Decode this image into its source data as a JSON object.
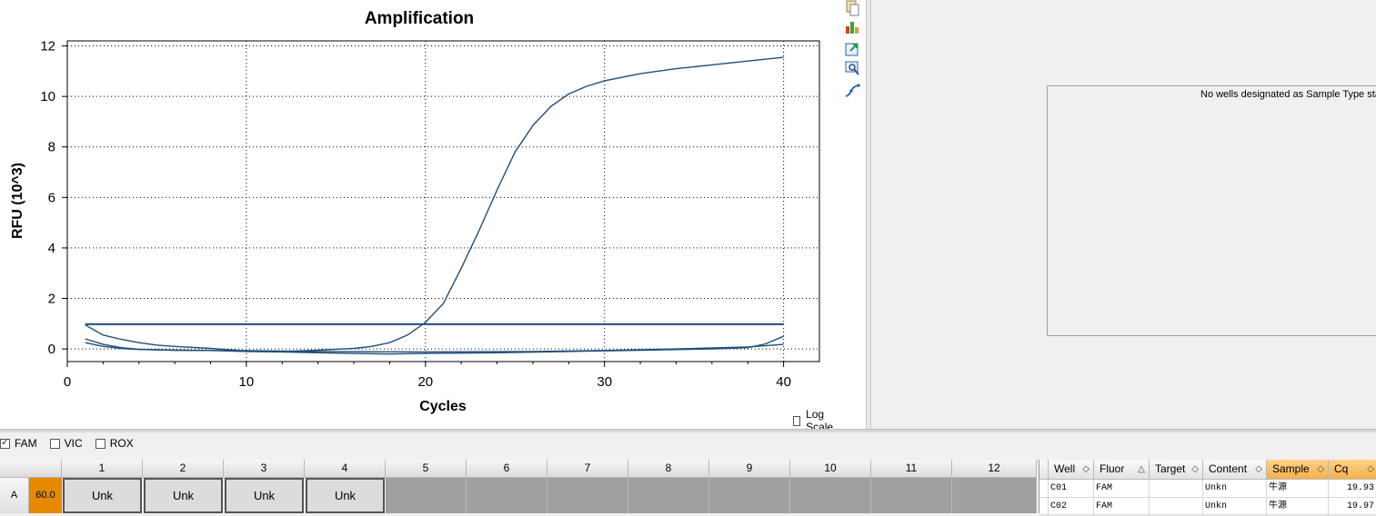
{
  "chart_data": {
    "type": "line",
    "title": "Amplification",
    "xlabel": "Cycles",
    "ylabel": "RFU (10^3)",
    "xlim": [
      0,
      42
    ],
    "ylim": [
      -0.5,
      12.2
    ],
    "xticks": [
      0,
      10,
      20,
      30,
      40
    ],
    "yticks": [
      0,
      2,
      4,
      6,
      8,
      10,
      12
    ],
    "grid": true,
    "threshold": 0.98,
    "series": [
      {
        "values": [
          [
            1,
            0.95
          ],
          [
            2,
            0.55
          ],
          [
            3,
            0.38
          ],
          [
            4,
            0.25
          ],
          [
            5,
            0.15
          ],
          [
            6,
            0.1
          ],
          [
            8,
            0.02
          ],
          [
            10,
            -0.08
          ],
          [
            12,
            -0.1
          ],
          [
            14,
            -0.05
          ],
          [
            16,
            0.02
          ],
          [
            17,
            0.1
          ],
          [
            18,
            0.25
          ],
          [
            19,
            0.55
          ],
          [
            20,
            1.05
          ],
          [
            21,
            1.8
          ],
          [
            22,
            3.2
          ],
          [
            23,
            4.7
          ],
          [
            24,
            6.3
          ],
          [
            25,
            7.8
          ],
          [
            26,
            8.85
          ],
          [
            27,
            9.6
          ],
          [
            28,
            10.1
          ],
          [
            29,
            10.4
          ],
          [
            30,
            10.62
          ],
          [
            32,
            10.9
          ],
          [
            34,
            11.1
          ],
          [
            36,
            11.25
          ],
          [
            38,
            11.4
          ],
          [
            40,
            11.55
          ]
        ]
      },
      {
        "values": [
          [
            1,
            0.4
          ],
          [
            2,
            0.18
          ],
          [
            3,
            0.05
          ],
          [
            4,
            -0.01
          ],
          [
            6,
            -0.05
          ],
          [
            8,
            -0.06
          ],
          [
            10,
            -0.1
          ],
          [
            12,
            -0.12
          ],
          [
            14,
            -0.15
          ],
          [
            16,
            -0.18
          ],
          [
            18,
            -0.2
          ],
          [
            20,
            -0.18
          ],
          [
            24,
            -0.15
          ],
          [
            28,
            -0.1
          ],
          [
            32,
            -0.05
          ],
          [
            36,
            0.0
          ],
          [
            38,
            0.05
          ],
          [
            39,
            0.2
          ],
          [
            40,
            0.5
          ]
        ]
      },
      {
        "values": [
          [
            1,
            0.25
          ],
          [
            2,
            0.1
          ],
          [
            3,
            0.02
          ],
          [
            4,
            -0.02
          ],
          [
            6,
            -0.05
          ],
          [
            8,
            -0.06
          ],
          [
            10,
            -0.07
          ],
          [
            14,
            -0.1
          ],
          [
            20,
            -0.12
          ],
          [
            26,
            -0.1
          ],
          [
            30,
            -0.06
          ],
          [
            34,
            0.0
          ],
          [
            38,
            0.08
          ],
          [
            40,
            0.18
          ]
        ]
      }
    ]
  },
  "log_scale_label": "Log Scale",
  "right_panel": {
    "message": "No wells designated as Sample Type sta"
  },
  "fluors": [
    {
      "label": "FAM",
      "checked": true
    },
    {
      "label": "VIC",
      "checked": false
    },
    {
      "label": "ROX",
      "checked": false
    }
  ],
  "plate": {
    "columns": [
      "1",
      "2",
      "3",
      "4",
      "5",
      "6",
      "7",
      "8",
      "9",
      "10",
      "11",
      "12"
    ],
    "row_label": "A",
    "row_value": "60.0",
    "wells": [
      "Unk",
      "Unk",
      "Unk",
      "Unk",
      "",
      "",
      "",
      "",
      "",
      "",
      "",
      ""
    ]
  },
  "table": {
    "headers": [
      "Well",
      "Fluor",
      "Target",
      "Content",
      "Sample",
      "Cq"
    ],
    "rows": [
      [
        "C01",
        "FAM",
        "",
        "Unkn",
        "牛源",
        "19.93"
      ],
      [
        "C02",
        "FAM",
        "",
        "Unkn",
        "牛源",
        "19.97"
      ]
    ]
  },
  "icons": [
    "copy-icon",
    "chart-settings-icon",
    "export-icon",
    "zoom-icon",
    "curve-icon"
  ]
}
